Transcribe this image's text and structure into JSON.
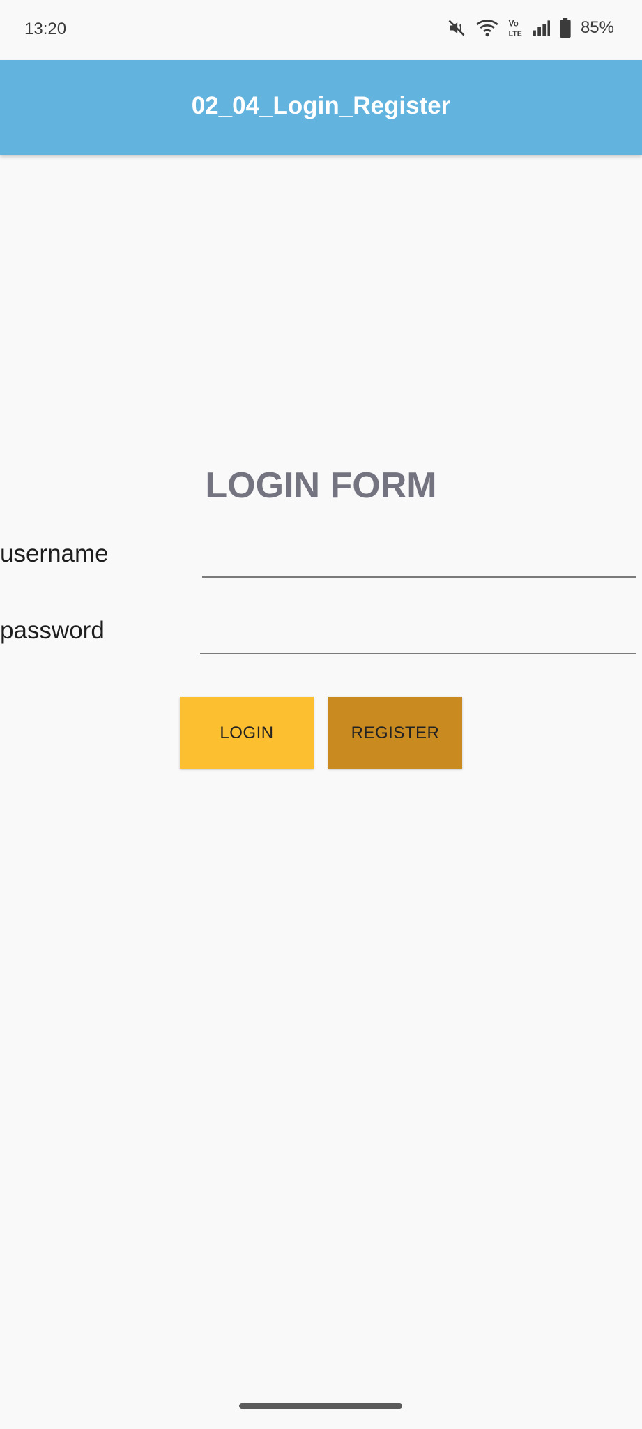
{
  "status_bar": {
    "time": "13:20",
    "battery": "85%",
    "icons": [
      "mute-icon",
      "wifi-icon",
      "volte-icon",
      "signal-icon",
      "battery-icon"
    ]
  },
  "app_bar": {
    "title": "02_04_Login_Register",
    "color": "#63b3df"
  },
  "form": {
    "heading": "LOGIN FORM",
    "username_label": "username",
    "username_value": "",
    "password_label": "password",
    "password_value": "",
    "login_button": "LOGIN",
    "register_button": "REGISTER",
    "login_color": "#fbbf30",
    "register_color": "#c98a20"
  }
}
